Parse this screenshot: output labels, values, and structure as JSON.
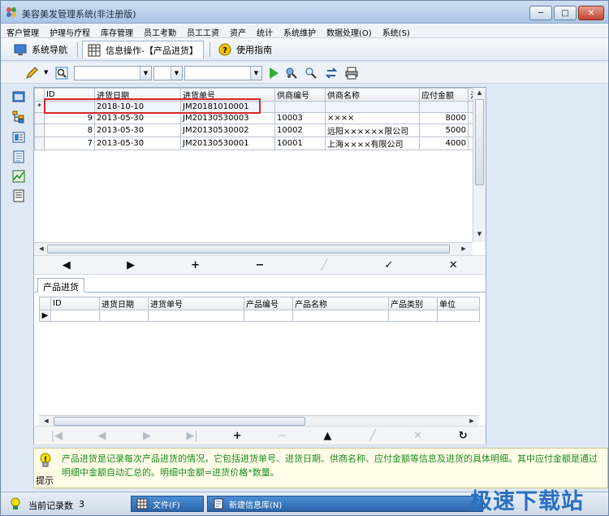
{
  "window": {
    "title": "美容美发管理系统(非注册版)",
    "controls": [
      "─",
      "□",
      "✕"
    ]
  },
  "menu": [
    "客户管理",
    "护理与疗程",
    "库存管理",
    "员工考勤",
    "员工工资",
    "资产",
    "统计",
    "系统维护",
    "数据处理(O)",
    "系统(S)"
  ],
  "nav": {
    "system_nav": "系统导航",
    "info_tab": "信息操作-【产品进货】",
    "guide": "使用指南"
  },
  "main_grid": {
    "columns": [
      "ID",
      "进货日期",
      "进货单号",
      "供商编号",
      "供商名称",
      "应付金额",
      "注"
    ],
    "new_row": {
      "date": "2018-10-10",
      "order_no": "JM20181010001"
    },
    "rows": [
      {
        "id": "9",
        "date": "2013-05-30",
        "order_no": "JM20130530003",
        "supplier_no": "10003",
        "supplier_name": "××××",
        "amount": "8000"
      },
      {
        "id": "8",
        "date": "2013-05-30",
        "order_no": "JM20130530002",
        "supplier_no": "10002",
        "supplier_name": "远阳××××××限公司",
        "amount": "5000"
      },
      {
        "id": "7",
        "date": "2013-05-30",
        "order_no": "JM20130530001",
        "supplier_no": "10001",
        "supplier_name": "上海××××有限公司",
        "amount": "4000"
      }
    ]
  },
  "main_nav_buttons": [
    "◀",
    "▶",
    "+",
    "−",
    "╱",
    "✓",
    "✕"
  ],
  "subtab": "产品进货",
  "detail_grid": {
    "columns": [
      "ID",
      "进货日期",
      "进货单号",
      "产品编号",
      "产品名称",
      "产品类别",
      "单位"
    ]
  },
  "detail_nav_buttons": [
    "|◀",
    "◀",
    "▶",
    "▶|",
    "+",
    "−",
    "▲",
    "╱",
    "✕",
    "↻"
  ],
  "hint": {
    "label": "提示",
    "text": "产品进货是记录每次产品进货的情况，它包括进货单号、进货日期、供商名称、应付金额等信息及进货的具体明细。其中应付金额是通过明细中金额自动汇总的。明细中金额=进货价格*数量。"
  },
  "status": {
    "record_count_label": "当前记录数",
    "record_count": "3",
    "task_file": "文件(F)",
    "task_newdb": "新建信息库(N)"
  },
  "watermark": "极速下载站",
  "colors": {
    "highlight_box": "#d9262a",
    "hint_text": "#1c8a1c",
    "watermark": "#2b6fc0"
  }
}
